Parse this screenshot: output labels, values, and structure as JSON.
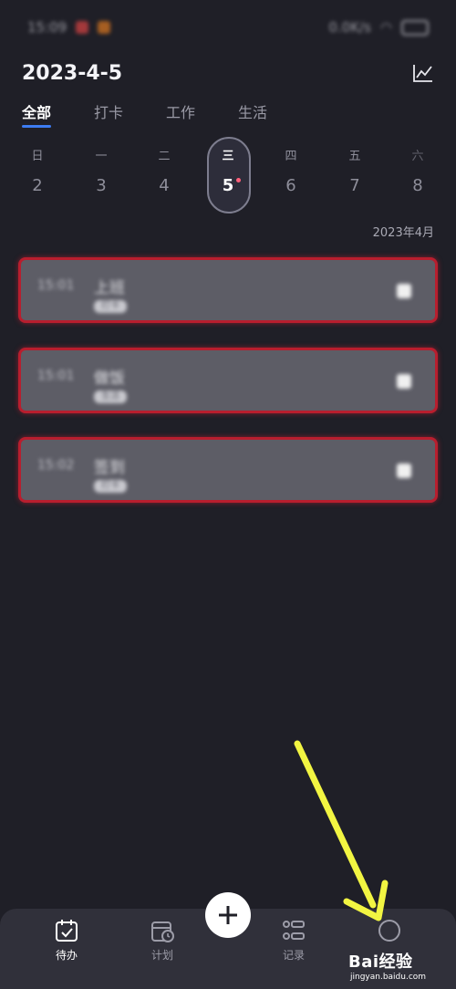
{
  "status_bar": {
    "time": "15:09",
    "speed": "0.0K/s"
  },
  "header": {
    "date": "2023-4-5",
    "chart_icon": "line-chart-icon"
  },
  "tabs": [
    {
      "label": "全部",
      "active": true
    },
    {
      "label": "打卡",
      "active": false
    },
    {
      "label": "工作",
      "active": false
    },
    {
      "label": "生活",
      "active": false
    }
  ],
  "week": [
    {
      "name": "日",
      "num": "2"
    },
    {
      "name": "一",
      "num": "3"
    },
    {
      "name": "二",
      "num": "4"
    },
    {
      "name": "三",
      "num": "5",
      "selected": true
    },
    {
      "name": "四",
      "num": "6"
    },
    {
      "name": "五",
      "num": "7"
    },
    {
      "name": "六",
      "num": "8"
    }
  ],
  "month_label": "2023年4月",
  "tasks": [
    {
      "time": "15:01",
      "title": "上班",
      "tag": "打卡"
    },
    {
      "time": "15:01",
      "title": "做饭",
      "tag": "生活"
    },
    {
      "time": "15:02",
      "title": "签到",
      "tag": "打卡"
    }
  ],
  "bottom_nav": {
    "todo_label": "待办",
    "plan_label": "计划",
    "record_label": "记录"
  },
  "watermark": {
    "main": "Bai经验",
    "sub": "jingyan.baidu.com"
  },
  "colors": {
    "accent": "#3d7cf2",
    "highlight_border": "#b81e2e",
    "arrow": "#f2f542"
  }
}
